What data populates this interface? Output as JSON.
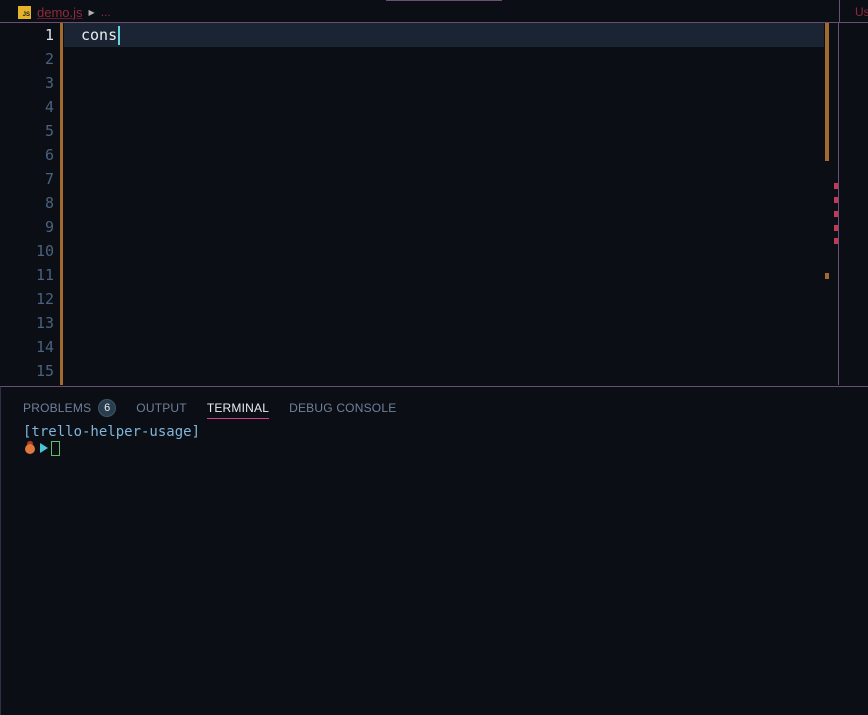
{
  "breadcrumb": {
    "file_icon": "javascript-file-icon",
    "file_name": "demo.js",
    "more": "..."
  },
  "right_tab": {
    "label": "Us"
  },
  "editor": {
    "line_numbers": [
      "1",
      "2",
      "3",
      "4",
      "5",
      "6",
      "7",
      "8",
      "9",
      "10",
      "11",
      "12",
      "13",
      "14",
      "15"
    ],
    "active_line": 1,
    "lines": [
      "cons"
    ]
  },
  "panel": {
    "tabs": [
      {
        "label": "PROBLEMS",
        "badge": "6"
      },
      {
        "label": "OUTPUT"
      },
      {
        "label": "TERMINAL"
      },
      {
        "label": "DEBUG CONSOLE"
      }
    ],
    "active_tab": "TERMINAL",
    "terminal": {
      "line1": "[trello-helper-usage]",
      "prompt_icon": "bug-icon"
    }
  },
  "colors": {
    "accent": "#d63f8a",
    "gutter_bar": "#a26a2c",
    "error_marker": "#c23a55",
    "background": "#0b0e15"
  }
}
